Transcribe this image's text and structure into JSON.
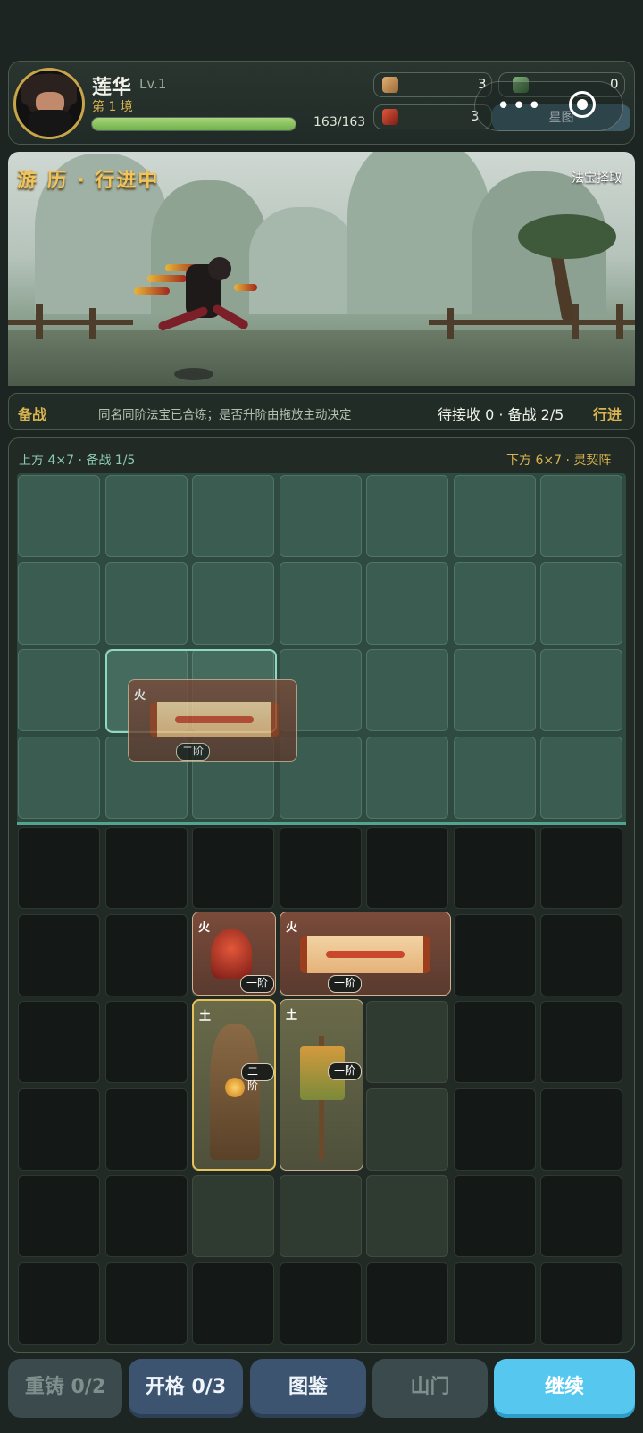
{
  "player": {
    "name": "莲华",
    "level": "Lv.1",
    "realm": "第 1 境",
    "hp_text": "163/163",
    "hp_fraction": 1.0
  },
  "resources": [
    {
      "icon": "spirit-beast-icon",
      "value": "3"
    },
    {
      "icon": "jade-pagoda-icon",
      "value": "0"
    },
    {
      "icon": "fire-beast-icon",
      "value": "3"
    }
  ],
  "miniprogram": {
    "star_map_label": "星图"
  },
  "scene": {
    "title": "游 历 · 行进中",
    "right_label": "法宝择取"
  },
  "status": {
    "left": "备战",
    "middle": "同名同阶法宝已合炼；是否升阶由拖放主动决定",
    "right": "待接收 0 · 备战 2/5",
    "go": "行进"
  },
  "board": {
    "upper_label": "上方 4×7 · 备战 1/5",
    "lower_label": "下方 6×7 · 灵契阵",
    "items": [
      {
        "id": "scroll-ghost",
        "element": "火",
        "tier": "二阶"
      },
      {
        "id": "fire-bell",
        "element": "火",
        "tier": "一阶"
      },
      {
        "id": "fire-scroll",
        "element": "火",
        "tier": "一阶"
      },
      {
        "id": "earth-stele",
        "element": "土",
        "tier": "二阶"
      },
      {
        "id": "earth-banner",
        "element": "土",
        "tier": "一阶"
      }
    ]
  },
  "buttons": {
    "recast": "重铸 0/2",
    "open_slot": "开格 0/3",
    "codex": "图鉴",
    "sect": "山门",
    "continue": "继续"
  },
  "colors": {
    "gold": "#d9b44f",
    "teal": "#8ecbb5",
    "continue_button": "#56c7ef"
  }
}
